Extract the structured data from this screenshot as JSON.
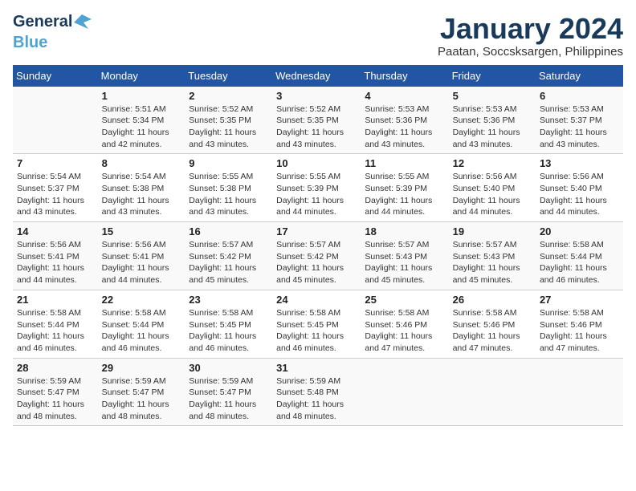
{
  "header": {
    "logo_general": "General",
    "logo_blue": "Blue",
    "title": "January 2024",
    "location": "Paatan, Soccsksargen, Philippines"
  },
  "weekdays": [
    "Sunday",
    "Monday",
    "Tuesday",
    "Wednesday",
    "Thursday",
    "Friday",
    "Saturday"
  ],
  "weeks": [
    [
      {
        "day": "",
        "sunrise": "",
        "sunset": "",
        "daylight": ""
      },
      {
        "day": "1",
        "sunrise": "Sunrise: 5:51 AM",
        "sunset": "Sunset: 5:34 PM",
        "daylight": "Daylight: 11 hours and 42 minutes."
      },
      {
        "day": "2",
        "sunrise": "Sunrise: 5:52 AM",
        "sunset": "Sunset: 5:35 PM",
        "daylight": "Daylight: 11 hours and 43 minutes."
      },
      {
        "day": "3",
        "sunrise": "Sunrise: 5:52 AM",
        "sunset": "Sunset: 5:35 PM",
        "daylight": "Daylight: 11 hours and 43 minutes."
      },
      {
        "day": "4",
        "sunrise": "Sunrise: 5:53 AM",
        "sunset": "Sunset: 5:36 PM",
        "daylight": "Daylight: 11 hours and 43 minutes."
      },
      {
        "day": "5",
        "sunrise": "Sunrise: 5:53 AM",
        "sunset": "Sunset: 5:36 PM",
        "daylight": "Daylight: 11 hours and 43 minutes."
      },
      {
        "day": "6",
        "sunrise": "Sunrise: 5:53 AM",
        "sunset": "Sunset: 5:37 PM",
        "daylight": "Daylight: 11 hours and 43 minutes."
      }
    ],
    [
      {
        "day": "7",
        "sunrise": "Sunrise: 5:54 AM",
        "sunset": "Sunset: 5:37 PM",
        "daylight": "Daylight: 11 hours and 43 minutes."
      },
      {
        "day": "8",
        "sunrise": "Sunrise: 5:54 AM",
        "sunset": "Sunset: 5:38 PM",
        "daylight": "Daylight: 11 hours and 43 minutes."
      },
      {
        "day": "9",
        "sunrise": "Sunrise: 5:55 AM",
        "sunset": "Sunset: 5:38 PM",
        "daylight": "Daylight: 11 hours and 43 minutes."
      },
      {
        "day": "10",
        "sunrise": "Sunrise: 5:55 AM",
        "sunset": "Sunset: 5:39 PM",
        "daylight": "Daylight: 11 hours and 44 minutes."
      },
      {
        "day": "11",
        "sunrise": "Sunrise: 5:55 AM",
        "sunset": "Sunset: 5:39 PM",
        "daylight": "Daylight: 11 hours and 44 minutes."
      },
      {
        "day": "12",
        "sunrise": "Sunrise: 5:56 AM",
        "sunset": "Sunset: 5:40 PM",
        "daylight": "Daylight: 11 hours and 44 minutes."
      },
      {
        "day": "13",
        "sunrise": "Sunrise: 5:56 AM",
        "sunset": "Sunset: 5:40 PM",
        "daylight": "Daylight: 11 hours and 44 minutes."
      }
    ],
    [
      {
        "day": "14",
        "sunrise": "Sunrise: 5:56 AM",
        "sunset": "Sunset: 5:41 PM",
        "daylight": "Daylight: 11 hours and 44 minutes."
      },
      {
        "day": "15",
        "sunrise": "Sunrise: 5:56 AM",
        "sunset": "Sunset: 5:41 PM",
        "daylight": "Daylight: 11 hours and 44 minutes."
      },
      {
        "day": "16",
        "sunrise": "Sunrise: 5:57 AM",
        "sunset": "Sunset: 5:42 PM",
        "daylight": "Daylight: 11 hours and 45 minutes."
      },
      {
        "day": "17",
        "sunrise": "Sunrise: 5:57 AM",
        "sunset": "Sunset: 5:42 PM",
        "daylight": "Daylight: 11 hours and 45 minutes."
      },
      {
        "day": "18",
        "sunrise": "Sunrise: 5:57 AM",
        "sunset": "Sunset: 5:43 PM",
        "daylight": "Daylight: 11 hours and 45 minutes."
      },
      {
        "day": "19",
        "sunrise": "Sunrise: 5:57 AM",
        "sunset": "Sunset: 5:43 PM",
        "daylight": "Daylight: 11 hours and 45 minutes."
      },
      {
        "day": "20",
        "sunrise": "Sunrise: 5:58 AM",
        "sunset": "Sunset: 5:44 PM",
        "daylight": "Daylight: 11 hours and 46 minutes."
      }
    ],
    [
      {
        "day": "21",
        "sunrise": "Sunrise: 5:58 AM",
        "sunset": "Sunset: 5:44 PM",
        "daylight": "Daylight: 11 hours and 46 minutes."
      },
      {
        "day": "22",
        "sunrise": "Sunrise: 5:58 AM",
        "sunset": "Sunset: 5:44 PM",
        "daylight": "Daylight: 11 hours and 46 minutes."
      },
      {
        "day": "23",
        "sunrise": "Sunrise: 5:58 AM",
        "sunset": "Sunset: 5:45 PM",
        "daylight": "Daylight: 11 hours and 46 minutes."
      },
      {
        "day": "24",
        "sunrise": "Sunrise: 5:58 AM",
        "sunset": "Sunset: 5:45 PM",
        "daylight": "Daylight: 11 hours and 46 minutes."
      },
      {
        "day": "25",
        "sunrise": "Sunrise: 5:58 AM",
        "sunset": "Sunset: 5:46 PM",
        "daylight": "Daylight: 11 hours and 47 minutes."
      },
      {
        "day": "26",
        "sunrise": "Sunrise: 5:58 AM",
        "sunset": "Sunset: 5:46 PM",
        "daylight": "Daylight: 11 hours and 47 minutes."
      },
      {
        "day": "27",
        "sunrise": "Sunrise: 5:58 AM",
        "sunset": "Sunset: 5:46 PM",
        "daylight": "Daylight: 11 hours and 47 minutes."
      }
    ],
    [
      {
        "day": "28",
        "sunrise": "Sunrise: 5:59 AM",
        "sunset": "Sunset: 5:47 PM",
        "daylight": "Daylight: 11 hours and 48 minutes."
      },
      {
        "day": "29",
        "sunrise": "Sunrise: 5:59 AM",
        "sunset": "Sunset: 5:47 PM",
        "daylight": "Daylight: 11 hours and 48 minutes."
      },
      {
        "day": "30",
        "sunrise": "Sunrise: 5:59 AM",
        "sunset": "Sunset: 5:47 PM",
        "daylight": "Daylight: 11 hours and 48 minutes."
      },
      {
        "day": "31",
        "sunrise": "Sunrise: 5:59 AM",
        "sunset": "Sunset: 5:48 PM",
        "daylight": "Daylight: 11 hours and 48 minutes."
      },
      {
        "day": "",
        "sunrise": "",
        "sunset": "",
        "daylight": ""
      },
      {
        "day": "",
        "sunrise": "",
        "sunset": "",
        "daylight": ""
      },
      {
        "day": "",
        "sunrise": "",
        "sunset": "",
        "daylight": ""
      }
    ]
  ]
}
